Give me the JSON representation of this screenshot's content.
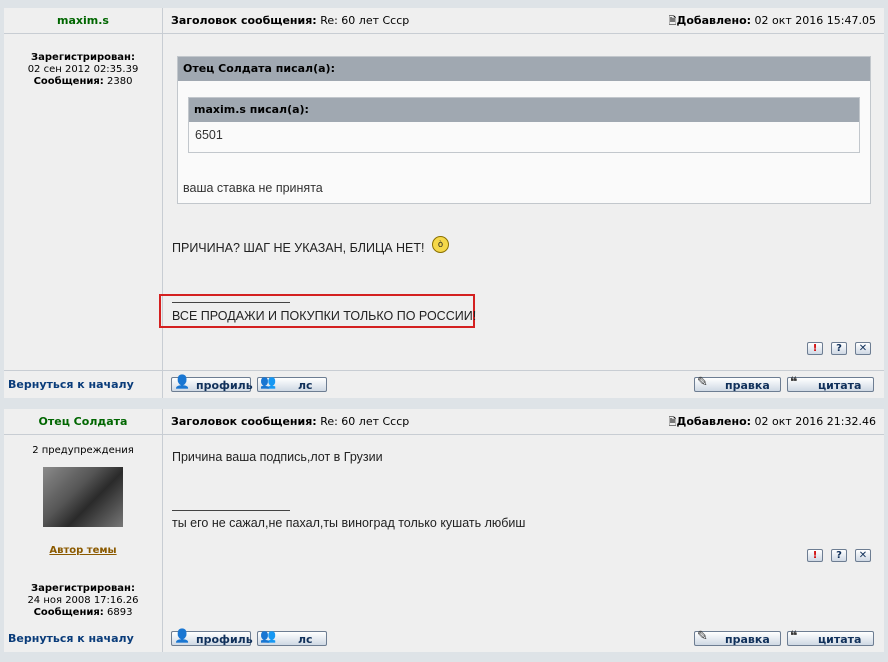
{
  "posts": [
    {
      "author": "maxim.s",
      "subject_label": "Заголовок сообщения:",
      "subject": "Re: 60 лет Ссср",
      "added_label": "Добавлено:",
      "added": "02 окт 2016 15:47.05",
      "registered_label": "Зарегистрирован:",
      "registered": "02 сен 2012 02:35.39",
      "messages_label": "Сообщения:",
      "messages": "2380",
      "quote_outer_header": "Отец Солдата писал(а):",
      "quote_inner_header": "maxim.s писал(а):",
      "quote_inner_text": "6501",
      "quote_outer_text": "ваша ставка не принята",
      "text": "ПРИЧИНА? ШАГ НЕ УКАЗАН, БЛИЦА НЕТ!",
      "signature": "ВСЕ ПРОДАЖИ И ПОКУПКИ ТОЛЬКО ПО РОССИИ!"
    },
    {
      "author": "Отец Солдата",
      "subject_label": "Заголовок сообщения:",
      "subject": "Re: 60 лет Ссср",
      "added_label": "Добавлено:",
      "added": "02 окт 2016 21:32.46",
      "warnings": "2 предупреждения",
      "topic_author": "Автор темы",
      "registered_label": "Зарегистрирован:",
      "registered": "24 ноя 2008 17:16.26",
      "messages_label": "Сообщения:",
      "messages": "6893",
      "text": "Причина ваша подпись,лот в Грузии",
      "signature": "ты его не сажал,не пахал,ты виноград только кушать любиш"
    }
  ],
  "footer": {
    "back_to_top": "Вернуться к началу",
    "profile": "профиль",
    "pm": "лс",
    "edit": "правка",
    "quote": "цитата"
  },
  "icons": {
    "report": "!",
    "help": "?",
    "delete": "✕"
  }
}
